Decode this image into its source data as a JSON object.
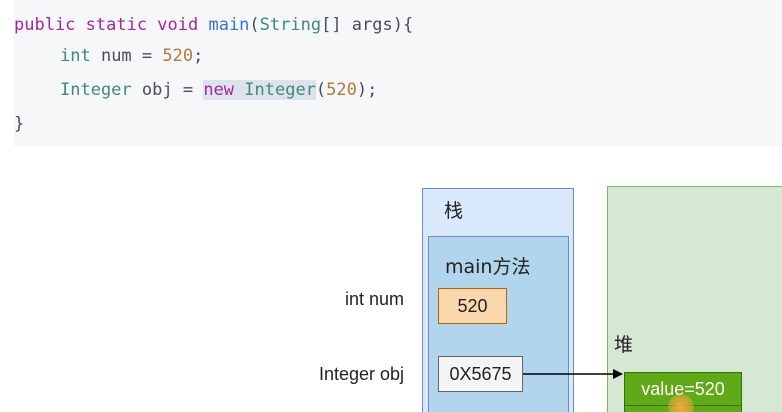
{
  "code": {
    "line1": {
      "kw1": "public static void ",
      "fn": "main",
      "p1": "(",
      "type": "String",
      "rest": "[] args){"
    },
    "line2": {
      "type": "int",
      "mid": " num = ",
      "num": "520",
      "end": ";"
    },
    "line3": {
      "type": "Integer",
      "mid": " obj = ",
      "hl_kw": "new ",
      "hl_type": "Integer",
      "p1": "(",
      "num": "520",
      "end": ");"
    },
    "line4": "}"
  },
  "diagram": {
    "stack_title": "栈",
    "frame_title": "main方法",
    "num_label": "int num",
    "num_value": "520",
    "obj_label": "Integer obj",
    "obj_value": "0X5675",
    "heap_title": "堆",
    "heap_value": "value=520"
  },
  "colors": {
    "stack_fill": "#dae8fc",
    "frame_fill": "#b1d5ec",
    "heap_fill": "#d5e8d4",
    "num_cell_fill": "#fad7ac",
    "value_cell_fill": "#60a917"
  }
}
